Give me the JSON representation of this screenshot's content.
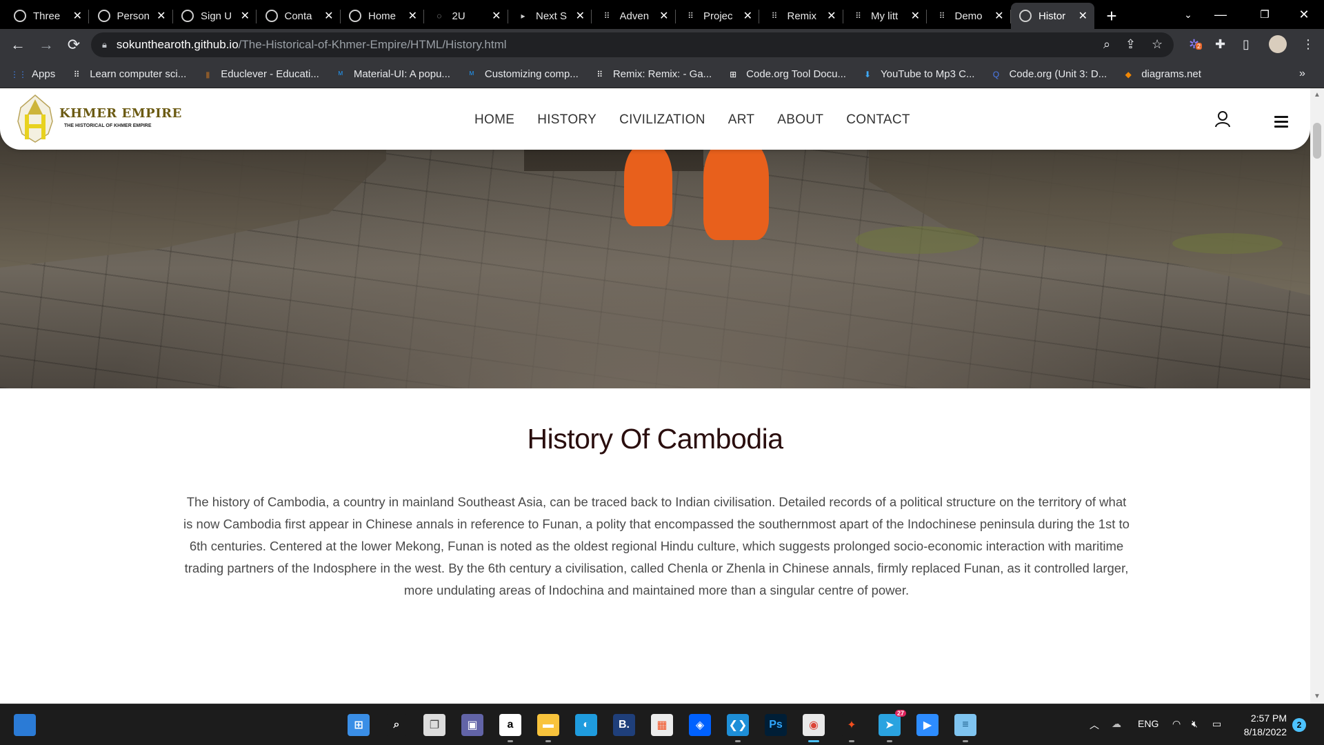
{
  "tabs": [
    {
      "title": "Three",
      "icon": "globe-icon"
    },
    {
      "title": "Person",
      "icon": "globe-icon"
    },
    {
      "title": "Sign U",
      "icon": "globe-icon"
    },
    {
      "title": "Conta",
      "icon": "globe-icon"
    },
    {
      "title": "Home",
      "icon": "globe-icon"
    },
    {
      "title": "2U",
      "icon": "loading-icon"
    },
    {
      "title": "Next S",
      "icon": "next-icon"
    },
    {
      "title": "Adven",
      "icon": "codesandbox-icon"
    },
    {
      "title": "Projec",
      "icon": "codesandbox-icon"
    },
    {
      "title": "Remix",
      "icon": "codesandbox-icon"
    },
    {
      "title": "My litt",
      "icon": "codesandbox-icon"
    },
    {
      "title": "Demo",
      "icon": "codesandbox-icon"
    },
    {
      "title": "Histor",
      "icon": "globe-icon",
      "active": true
    }
  ],
  "address_bar": {
    "host": "sokunthearoth.github.io",
    "path": "/The-Historical-of-Khmer-Empire/HTML/History.html"
  },
  "bookmarks": [
    {
      "label": "Apps",
      "icon": "apps-grid-icon",
      "color": "#4285f4"
    },
    {
      "label": "Learn computer sci...",
      "icon": "codesandbox-icon",
      "color": "#ffffff"
    },
    {
      "label": "Educlever - Educati...",
      "icon": "educlever-icon",
      "color": "#8a5a2b"
    },
    {
      "label": "Material-UI: A popu...",
      "icon": "mui-icon",
      "color": "#2196f3"
    },
    {
      "label": "Customizing comp...",
      "icon": "mui-icon",
      "color": "#2196f3"
    },
    {
      "label": "Remix: Remix: - Ga...",
      "icon": "codesandbox-icon",
      "color": "#ffffff"
    },
    {
      "label": "Code.org Tool Docu...",
      "icon": "codeorg-icon",
      "color": "#ffffff"
    },
    {
      "label": "YouTube to Mp3 C...",
      "icon": "download-icon",
      "color": "#3fa9f5"
    },
    {
      "label": "Code.org (Unit 3: D...",
      "icon": "search-q-icon",
      "color": "#4b7bec"
    },
    {
      "label": "diagrams.net",
      "icon": "diagrams-icon",
      "color": "#f08705"
    }
  ],
  "site": {
    "brand": "KHMER EMPIRE",
    "brand_sub": "THE HISTORICAL OF KHMER EMPIRE",
    "menu": [
      "HOME",
      "HISTORY",
      "CIVILIZATION",
      "ART",
      "ABOUT",
      "CONTACT"
    ]
  },
  "content": {
    "title": "History Of Cambodia",
    "body": "The history of Cambodia, a country in mainland Southeast Asia, can be traced back to Indian civilisation. Detailed records of a political structure on the territory of what is now Cambodia first appear in Chinese annals in reference to Funan, a polity that encompassed the southernmost apart of the Indochinese peninsula during the 1st to 6th centuries. Centered at the lower Mekong, Funan is noted as the oldest regional Hindu culture, which suggests prolonged socio-economic interaction with maritime trading partners of the Indosphere in the west. By the 6th century a civilisation, called Chenla or Zhenla in Chinese annals, firmly replaced Funan, as it controlled larger, more undulating areas of Indochina and maintained more than a singular centre of power."
  },
  "taskbar": {
    "apps": [
      {
        "name": "start-icon",
        "label": ""
      },
      {
        "name": "search-icon",
        "label": ""
      },
      {
        "name": "task-view-icon",
        "label": ""
      },
      {
        "name": "teams-chat-icon",
        "label": ""
      },
      {
        "name": "amazon-icon",
        "label": "a"
      },
      {
        "name": "file-explorer-icon",
        "label": ""
      },
      {
        "name": "edge-icon",
        "label": ""
      },
      {
        "name": "booking-icon",
        "label": "B."
      },
      {
        "name": "ms-store-icon",
        "label": ""
      },
      {
        "name": "dropbox-icon",
        "label": ""
      },
      {
        "name": "vscode-icon",
        "label": ""
      },
      {
        "name": "photoshop-icon",
        "label": "Ps"
      },
      {
        "name": "chrome-icon",
        "label": ""
      },
      {
        "name": "figma-icon",
        "label": ""
      },
      {
        "name": "telegram-icon",
        "label": ""
      },
      {
        "name": "zoom-icon",
        "label": ""
      },
      {
        "name": "notepad-icon",
        "label": ""
      }
    ],
    "telegram_badge": "27",
    "language": "ENG",
    "time": "2:57 PM",
    "date": "8/18/2022",
    "notifications": "2"
  },
  "extension_badge": "2"
}
